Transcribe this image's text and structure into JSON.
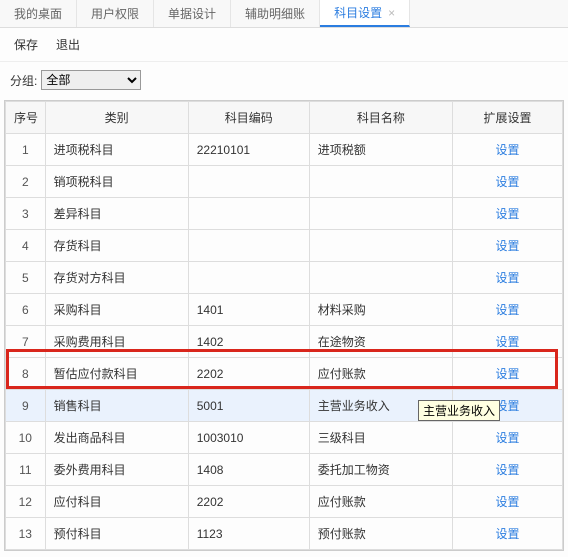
{
  "tabs": {
    "items": [
      {
        "label": "我的桌面"
      },
      {
        "label": "用户权限"
      },
      {
        "label": "单据设计"
      },
      {
        "label": "辅助明细账"
      },
      {
        "label": "科目设置",
        "active": true,
        "close": "×"
      }
    ]
  },
  "toolbar": {
    "save_label": "保存",
    "exit_label": "退出"
  },
  "filter": {
    "group_label": "分组:",
    "group_value": "全部"
  },
  "grid": {
    "headers": {
      "seq": "序号",
      "category": "类别",
      "code": "科目编码",
      "name": "科目名称",
      "ext": "扩展设置"
    },
    "ext_link_label": "设置",
    "rows": [
      {
        "seq": "1",
        "category": "进项税科目",
        "code": "22210101",
        "name": "进项税额"
      },
      {
        "seq": "2",
        "category": "销项税科目",
        "code": "",
        "name": ""
      },
      {
        "seq": "3",
        "category": "差异科目",
        "code": "",
        "name": ""
      },
      {
        "seq": "4",
        "category": "存货科目",
        "code": "",
        "name": ""
      },
      {
        "seq": "5",
        "category": "存货对方科目",
        "code": "",
        "name": ""
      },
      {
        "seq": "6",
        "category": "采购科目",
        "code": "1401",
        "name": "材料采购"
      },
      {
        "seq": "7",
        "category": "采购费用科目",
        "code": "1402",
        "name": "在途物资"
      },
      {
        "seq": "8",
        "category": "暂估应付款科目",
        "code": "2202",
        "name": "应付账款"
      },
      {
        "seq": "9",
        "category": "销售科目",
        "code": "5001",
        "name": "主营业务收入",
        "selected": true
      },
      {
        "seq": "10",
        "category": "发出商品科目",
        "code": "1003010",
        "name": "三级科目"
      },
      {
        "seq": "11",
        "category": "委外费用科目",
        "code": "1408",
        "name": "委托加工物资"
      },
      {
        "seq": "12",
        "category": "应付科目",
        "code": "2202",
        "name": "应付账款"
      },
      {
        "seq": "13",
        "category": "预付科目",
        "code": "1123",
        "name": "预付账款"
      }
    ]
  },
  "tooltip": {
    "text": "主营业务收入"
  }
}
